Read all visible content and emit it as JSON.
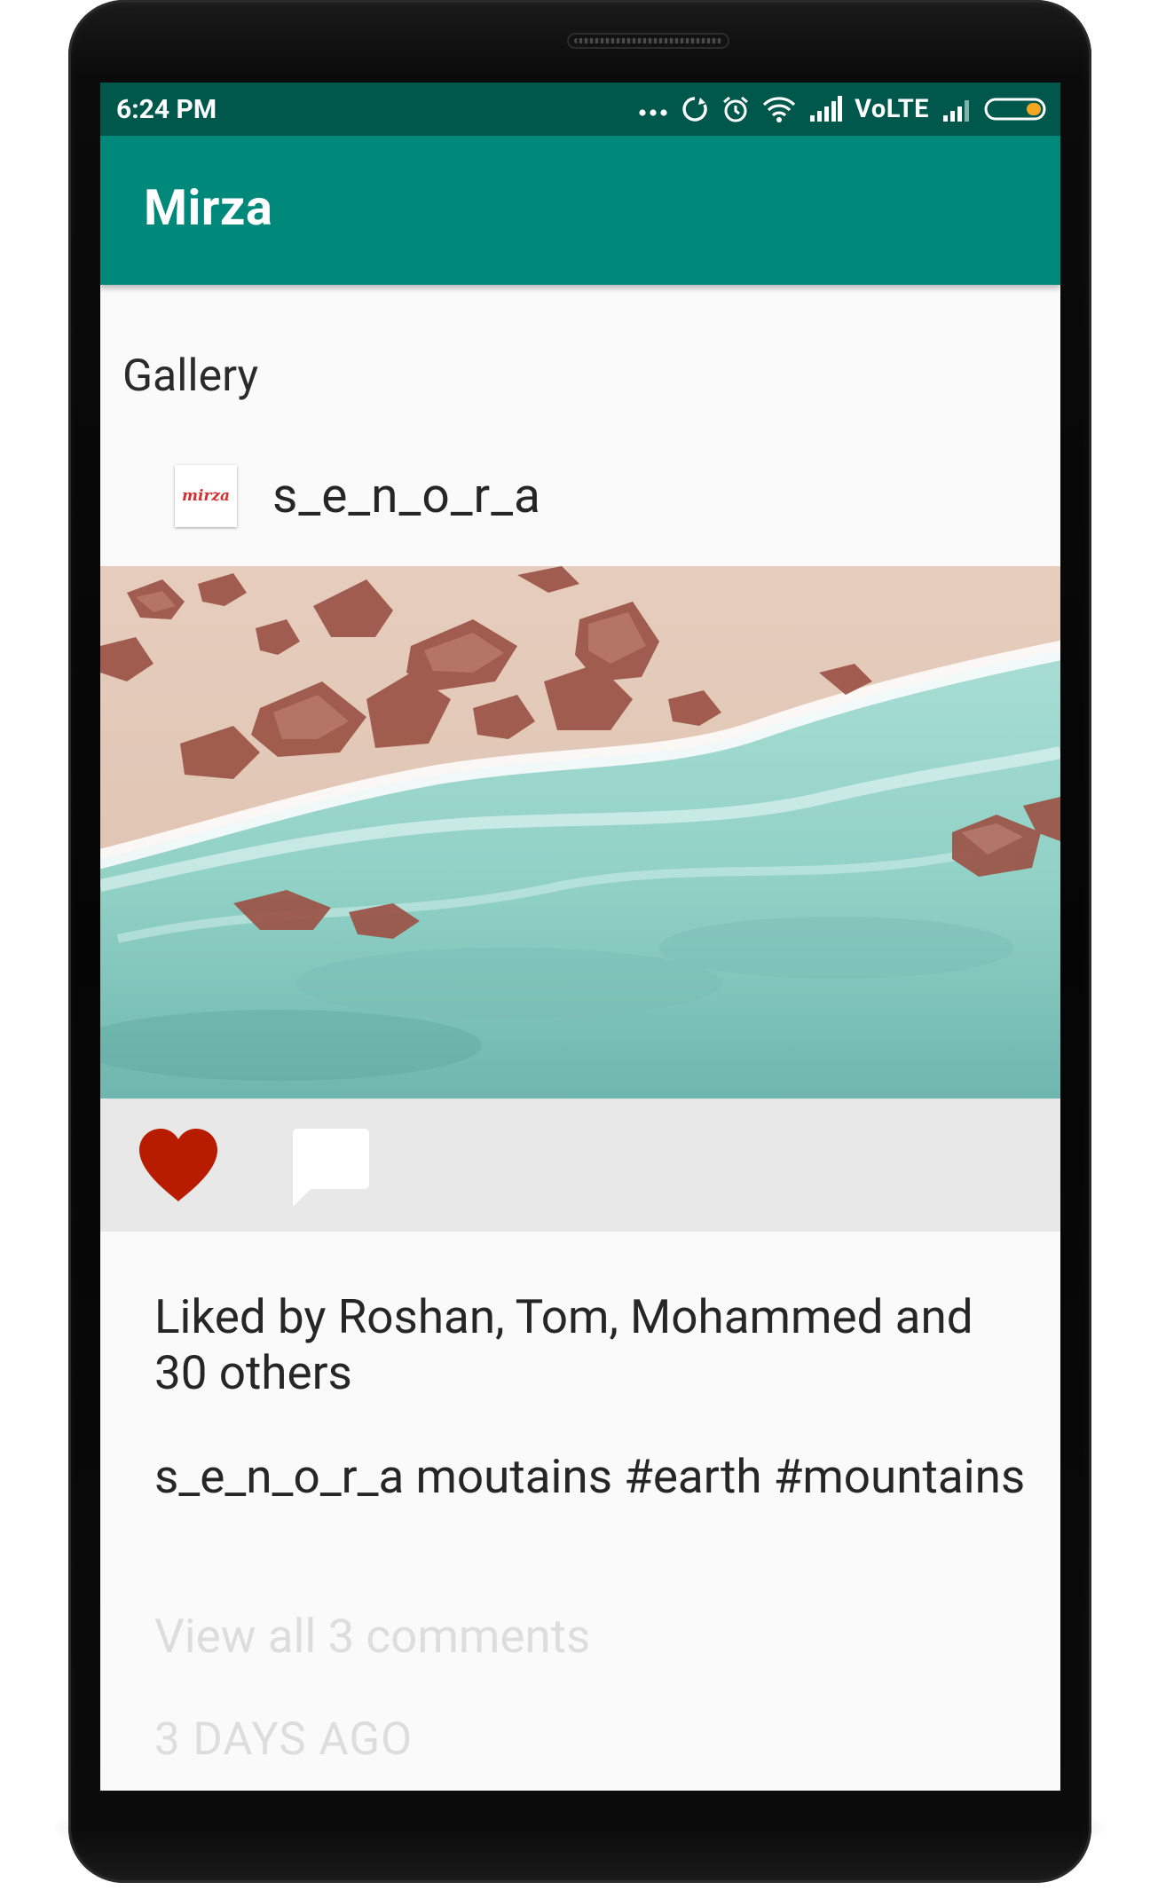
{
  "status_bar": {
    "time": "6:24 PM",
    "network_label": "VoLTE",
    "background_color": "#00574b",
    "icons": [
      "more-dots-icon",
      "sync-icon",
      "alarm-icon",
      "wifi-icon",
      "signal-icon",
      "signal-weak-icon",
      "battery-icon"
    ],
    "battery_accent": "#f5a623"
  },
  "app_bar": {
    "title": "Mirza",
    "background_color": "#00897b"
  },
  "gallery": {
    "section_label": "Gallery"
  },
  "post": {
    "username": "s_e_n_o_r_a",
    "avatar_text": "mirza",
    "image_description_icon": "beach-photo",
    "like_icon": "heart-icon",
    "comment_icon": "comment-icon",
    "like_color": "#b71c00",
    "likes_text": "Liked by Roshan, Tom, Mohammed and 30 others",
    "caption": "s_e_n_o_r_a moutains #earth #mountains",
    "view_comments": "View all 3 comments",
    "timestamp": "3 DAYS AGO"
  }
}
